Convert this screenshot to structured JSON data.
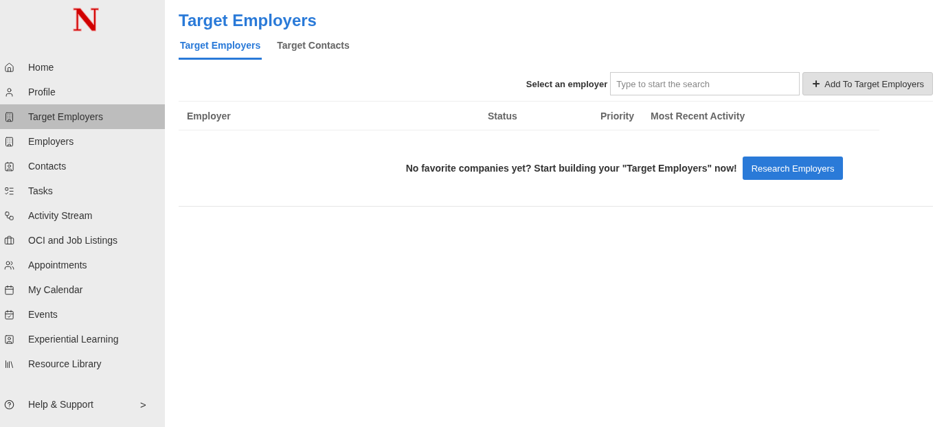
{
  "sidebar": {
    "logo": "N",
    "items": [
      {
        "label": "Home",
        "selected": false
      },
      {
        "label": "Profile",
        "selected": false
      },
      {
        "label": "Target Employers",
        "selected": true
      },
      {
        "label": "Employers",
        "selected": false
      },
      {
        "label": "Contacts",
        "selected": false
      },
      {
        "label": "Tasks",
        "selected": false
      },
      {
        "label": "Activity Stream",
        "selected": false
      },
      {
        "label": "OCI and Job Listings",
        "selected": false
      },
      {
        "label": "Appointments",
        "selected": false
      },
      {
        "label": "My Calendar",
        "selected": false
      },
      {
        "label": "Events",
        "selected": false
      },
      {
        "label": "Experiential Learning",
        "selected": false
      },
      {
        "label": "Resource Library",
        "selected": false
      }
    ],
    "help": {
      "label": "Help & Support",
      "expand": ">"
    }
  },
  "page": {
    "title": "Target Employers",
    "tabs": [
      {
        "label": "Target Employers",
        "selected": true
      },
      {
        "label": "Target Contacts",
        "selected": false
      }
    ],
    "search": {
      "label": "Select an employer",
      "placeholder": "Type to start the search",
      "button": "Add To Target Employers"
    },
    "table": {
      "columns": [
        "Employer",
        "Status",
        "Priority",
        "Most Recent Activity"
      ],
      "empty_message": "No favorite companies yet? Start building your \"Target Employers\" now!",
      "empty_button": "Research Employers"
    }
  }
}
